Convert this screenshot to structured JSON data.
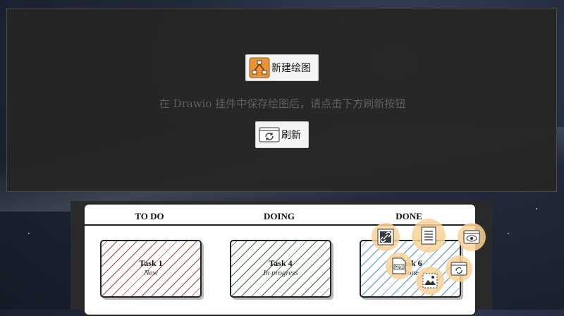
{
  "panel": {
    "new_button_label": "新建绘图",
    "hint_text": "在 Drawio 挂件中保存绘图后，请点击下方刷新按钮",
    "refresh_button_label": "刷新"
  },
  "board": {
    "columns": [
      "TO DO",
      "DOING",
      "DONE"
    ],
    "cards": [
      {
        "title": "Task 1",
        "status": "New"
      },
      {
        "title": "Task 4",
        "status": "In progress"
      },
      {
        "title": "Task 6",
        "status": "Done"
      }
    ]
  },
  "overlay_icons": [
    "link-icon",
    "list-icon",
    "preview-icon",
    "png-export-icon",
    "image-select-icon",
    "refresh-icon"
  ],
  "colors": {
    "accent_orange": "#e8923a",
    "fab_bg": "#fad296",
    "card_red": "#9a4a3a",
    "card_green": "#3d6e3a",
    "card_blue": "#4d8fcf"
  }
}
